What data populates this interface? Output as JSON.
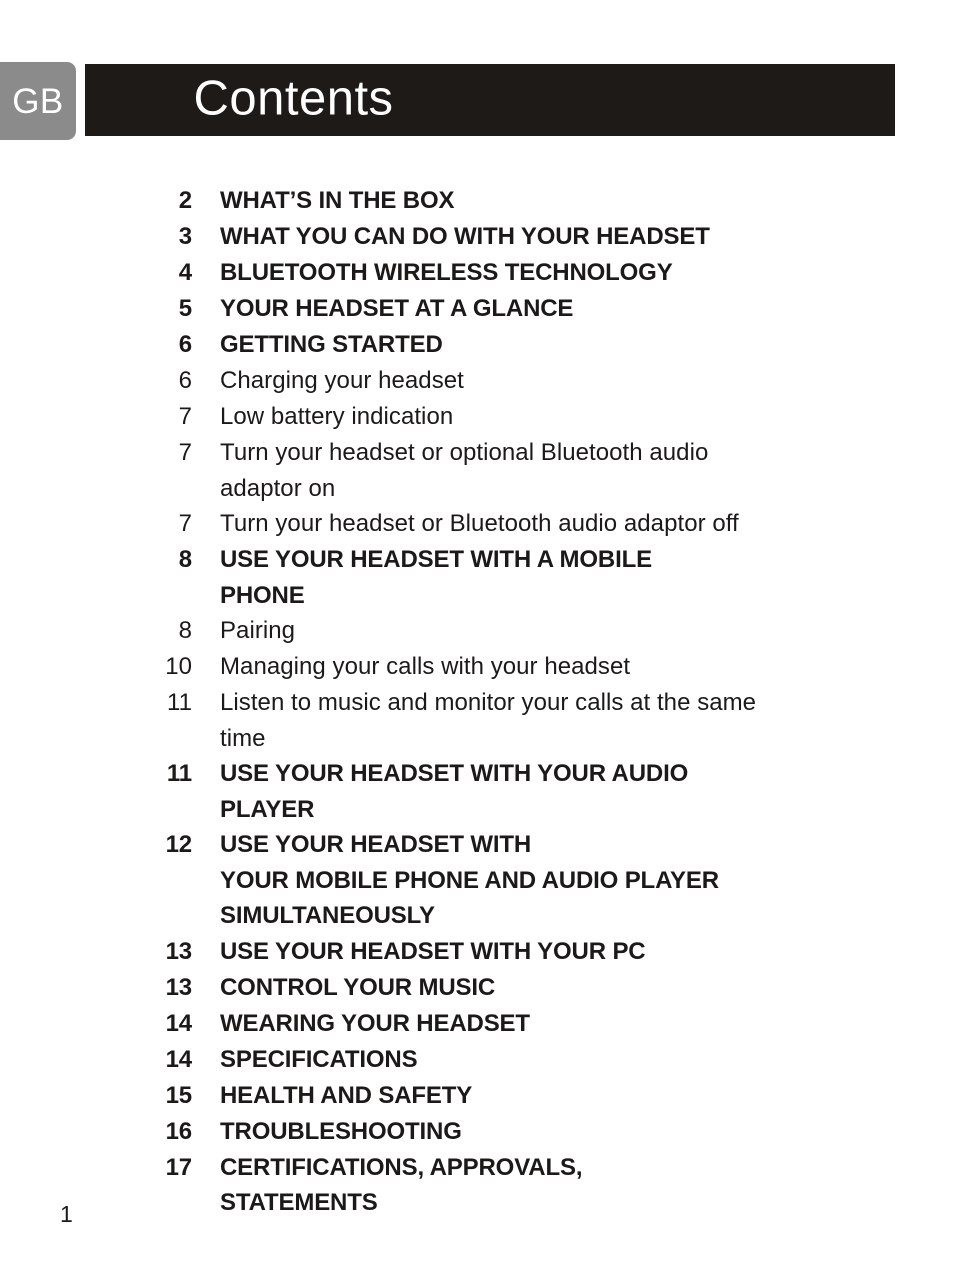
{
  "header": {
    "language_badge": "GB",
    "title": "Contents",
    "badge_color": "#8b8b8b",
    "bar_color": "#1e1a18",
    "title_color": "#ffffff"
  },
  "contents": {
    "entries": [
      {
        "page": "2",
        "label": "WHAT’S IN THE BOX",
        "level": "major",
        "lines": [
          "WHAT’S IN THE BOX"
        ]
      },
      {
        "page": "3",
        "label": "WHAT YOU CAN DO WITH YOUR HEADSET",
        "level": "major",
        "lines": [
          "WHAT YOU CAN DO WITH YOUR HEADSET"
        ]
      },
      {
        "page": "4",
        "label": "BLUETOOTH WIRELESS TECHNOLOGY",
        "level": "major",
        "lines": [
          "BLUETOOTH WIRELESS TECHNOLOGY"
        ]
      },
      {
        "page": "5",
        "label": "YOUR HEADSET AT A GLANCE",
        "level": "major",
        "lines": [
          "YOUR HEADSET AT A GLANCE"
        ]
      },
      {
        "page": "6",
        "label": "GETTING STARTED",
        "level": "major",
        "lines": [
          "GETTING STARTED"
        ]
      },
      {
        "page": "6",
        "label": "Charging your headset",
        "level": "minor",
        "lines": [
          "Charging your headset"
        ]
      },
      {
        "page": "7",
        "label": "Low battery indication",
        "level": "minor",
        "lines": [
          "Low battery indication"
        ]
      },
      {
        "page": "7",
        "label": "Turn your headset or optional Bluetooth audio adaptor on",
        "level": "minor",
        "lines": [
          "Turn your headset or optional Bluetooth audio",
          "adaptor on"
        ]
      },
      {
        "page": "7",
        "label": "Turn your headset or Bluetooth audio adaptor off",
        "level": "minor",
        "lines": [
          "Turn your headset or Bluetooth audio adaptor off"
        ]
      },
      {
        "page": "8",
        "label": "USE YOUR HEADSET WITH A MOBILE PHONE",
        "level": "major",
        "lines": [
          "USE YOUR HEADSET WITH A MOBILE",
          "PHONE"
        ]
      },
      {
        "page": "8",
        "label": "Pairing",
        "level": "minor",
        "lines": [
          "Pairing"
        ]
      },
      {
        "page": "10",
        "label": "Managing your calls with your headset",
        "level": "minor",
        "lines": [
          "Managing your calls with your headset"
        ]
      },
      {
        "page": "11",
        "label": "Listen to music and monitor your calls at the same time",
        "level": "minor",
        "lines": [
          "Listen to music and monitor your calls at the same",
          "time"
        ]
      },
      {
        "page": "11",
        "label": "USE YOUR HEADSET WITH YOUR AUDIO PLAYER",
        "level": "major",
        "lines": [
          "USE YOUR HEADSET WITH YOUR AUDIO",
          "PLAYER"
        ]
      },
      {
        "page": "12",
        "label": "USE YOUR HEADSET WITH YOUR MOBILE PHONE AND AUDIO PLAYER SIMULTANEOUSLY",
        "level": "major",
        "lines": [
          "USE YOUR HEADSET WITH",
          "YOUR MOBILE PHONE AND AUDIO PLAYER",
          "SIMULTANEOUSLY"
        ]
      },
      {
        "page": "13",
        "label": "USE YOUR HEADSET WITH YOUR PC",
        "level": "major",
        "lines": [
          "USE YOUR HEADSET WITH YOUR PC"
        ]
      },
      {
        "page": "13",
        "label": "CONTROL YOUR MUSIC",
        "level": "major",
        "lines": [
          "CONTROL YOUR MUSIC"
        ]
      },
      {
        "page": "14",
        "label": "WEARING YOUR HEADSET",
        "level": "major",
        "lines": [
          "WEARING YOUR HEADSET"
        ]
      },
      {
        "page": "14",
        "label": "SPECIFICATIONS",
        "level": "major",
        "lines": [
          "SPECIFICATIONS"
        ]
      },
      {
        "page": "15",
        "label": "HEALTH AND SAFETY",
        "level": "major",
        "lines": [
          "HEALTH AND SAFETY"
        ]
      },
      {
        "page": "16",
        "label": "TROUBLESHOOTING",
        "level": "major",
        "lines": [
          "TROUBLESHOOTING"
        ]
      },
      {
        "page": "17",
        "label": "CERTIFICATIONS, APPROVALS, STATEMENTS",
        "level": "major",
        "lines": [
          "CERTIFICATIONS, APPROVALS,",
          "STATEMENTS"
        ]
      }
    ]
  },
  "footer": {
    "page_number": "1"
  }
}
